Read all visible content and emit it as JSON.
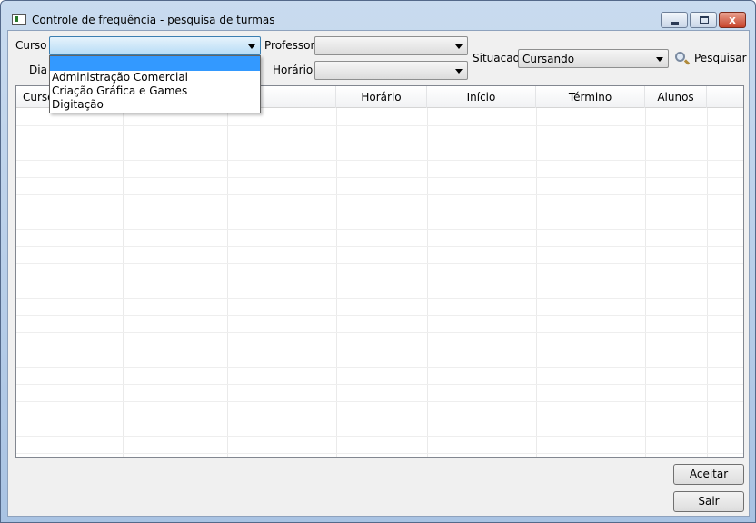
{
  "window": {
    "title": "Controle de frequência - pesquisa de turmas",
    "minimize_icon": "minimize-icon",
    "maximize_icon": "maximize-icon",
    "close_icon": "close-icon",
    "close_glyph": "x"
  },
  "filters": {
    "curso_label": "Curso",
    "curso_value": "",
    "professor_label": "Professor",
    "professor_value": "",
    "situacao_label": "Situacao",
    "situacao_value": "Cursando",
    "dia_label": "Dia",
    "horario_label": "Horário",
    "horario_value": ""
  },
  "curso_dropdown": {
    "options": [
      "",
      "Administração Comercial",
      "Criação Gráfica e Games",
      "Digitação"
    ],
    "selected_index": 0
  },
  "search": {
    "label": "Pesquisar",
    "icon": "magnifier-icon"
  },
  "grid": {
    "columns": [
      "Curso",
      "",
      "",
      "Horário",
      "Início",
      "Término",
      "Alunos",
      ""
    ],
    "rows": []
  },
  "buttons": {
    "accept_label": "Aceitar",
    "exit_label": "Sair"
  },
  "colors": {
    "selection": "#3399ff",
    "window_frame": "#a9c3e3",
    "client_bg": "#f0f0f0"
  }
}
